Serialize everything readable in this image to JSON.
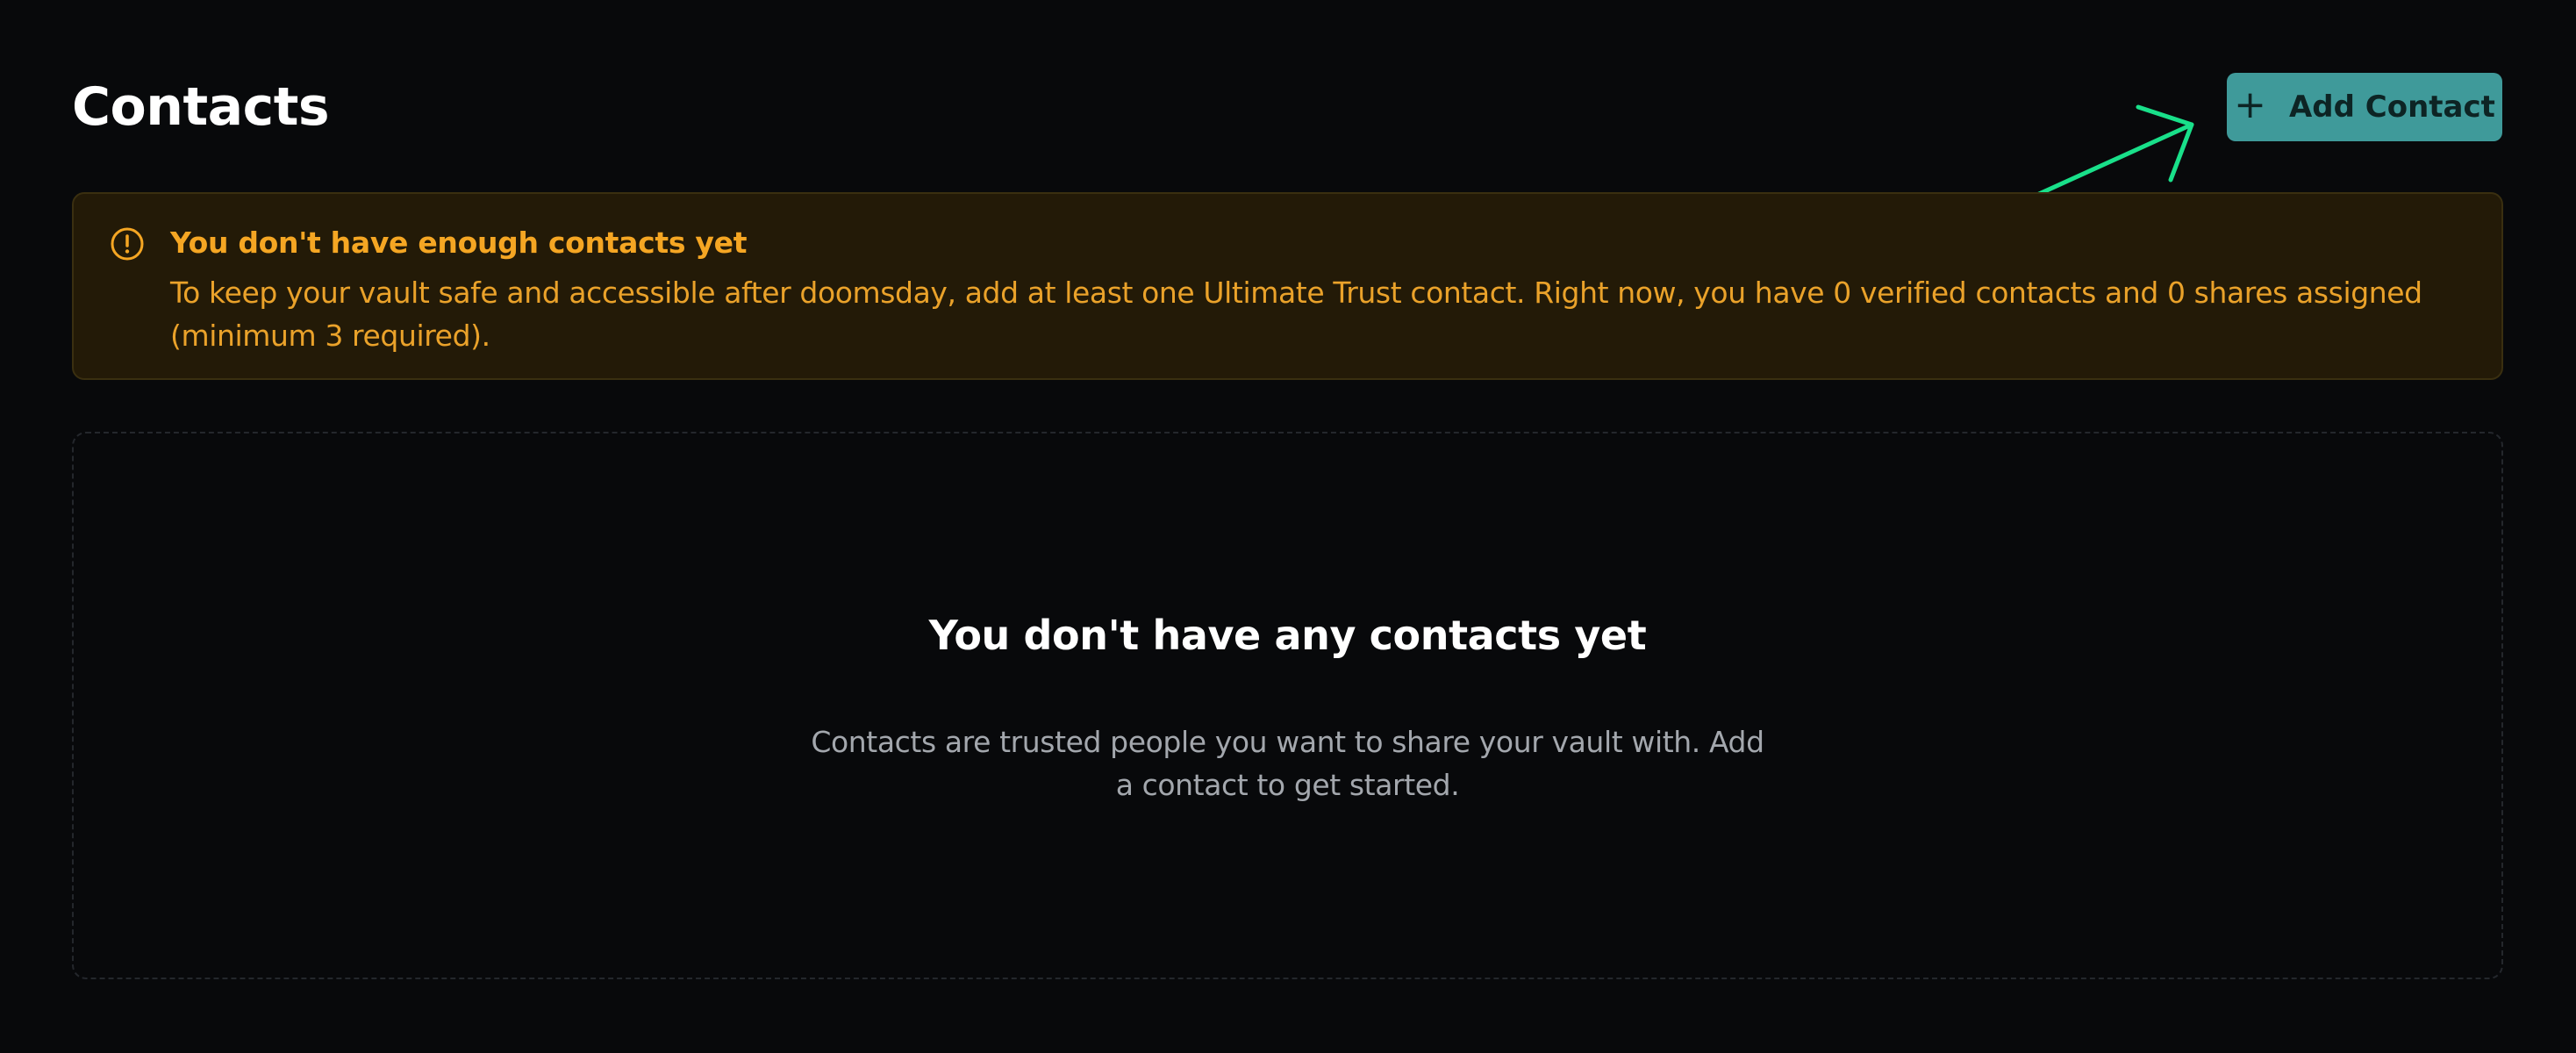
{
  "header": {
    "title": "Contacts",
    "add_button_label": "Add Contact",
    "add_button_icon": "+"
  },
  "warning": {
    "icon": "alert-circle-icon",
    "title": "You don't have enough contacts yet",
    "message": "To keep your vault safe and accessible after doomsday, add at least one Ultimate Trust contact. Right now, you have 0 verified contacts and 0 shares assigned (minimum 3 required)."
  },
  "empty_state": {
    "title": "You don't have any contacts yet",
    "message": "Contacts are trusted people you want to share your vault with. Add a contact to get started."
  },
  "colors": {
    "background": "#08090b",
    "accent": "#3f9a9a",
    "warning_text": "#f5a623",
    "warning_bg": "#231a07",
    "annotation_arrow": "#19e08a"
  }
}
